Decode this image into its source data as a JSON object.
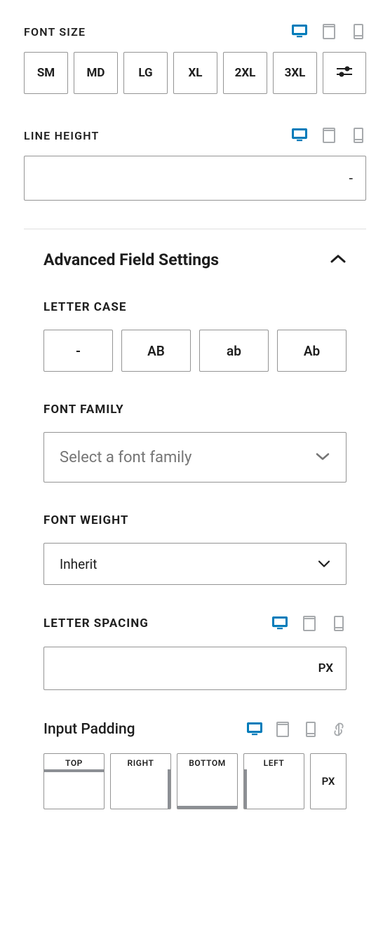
{
  "font_size": {
    "label": "FONT SIZE",
    "options": [
      "SM",
      "MD",
      "LG",
      "XL",
      "2XL",
      "3XL"
    ]
  },
  "line_height": {
    "label": "LINE HEIGHT",
    "value": "-"
  },
  "advanced": {
    "title": "Advanced Field Settings",
    "expanded": true
  },
  "letter_case": {
    "label": "LETTER CASE",
    "options": [
      "-",
      "AB",
      "ab",
      "Ab"
    ]
  },
  "font_family": {
    "label": "FONT FAMILY",
    "placeholder": "Select a font family"
  },
  "font_weight": {
    "label": "FONT WEIGHT",
    "value": "Inherit"
  },
  "letter_spacing": {
    "label": "LETTER SPACING",
    "unit": "PX"
  },
  "input_padding": {
    "title": "Input Padding",
    "sides": {
      "top": "TOP",
      "right": "RIGHT",
      "bottom": "BOTTOM",
      "left": "LEFT"
    },
    "unit": "PX"
  }
}
